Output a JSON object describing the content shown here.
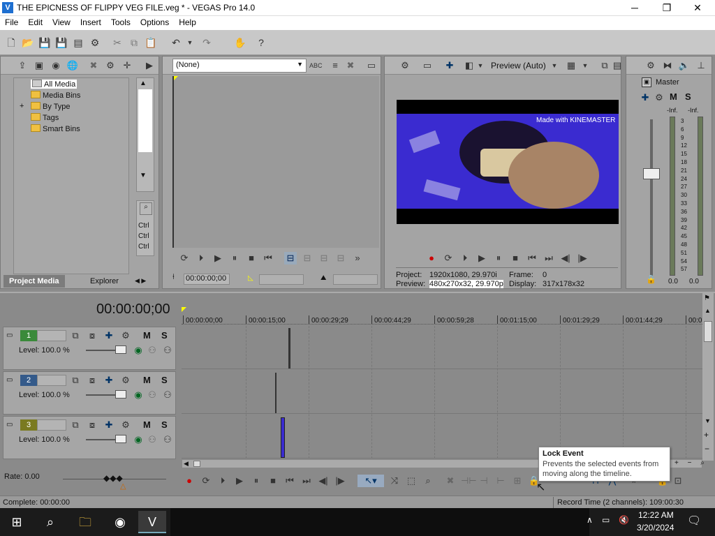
{
  "window": {
    "title": "THE EPICNESS OF FLIPPY VEG FILE.veg * - VEGAS Pro 14.0",
    "minimize": "─",
    "maximize": "❐",
    "close": "✕"
  },
  "menu": [
    "File",
    "Edit",
    "View",
    "Insert",
    "Tools",
    "Options",
    "Help"
  ],
  "project_media": {
    "tree": [
      "All Media",
      "Media Bins",
      "By Type",
      "Tags",
      "Smart Bins"
    ],
    "expander": "+",
    "tabs": [
      "Project Media",
      "Explorer"
    ],
    "ctrl": [
      "Ctrl",
      "Ctrl",
      "Ctrl"
    ]
  },
  "trimmer": {
    "dropdown": "(None)",
    "timecode": "00:00:00;00"
  },
  "preview": {
    "mode": "Preview (Auto)",
    "watermark": "Made with KINEMASTER",
    "project_label": "Project:",
    "project_value": "1920x1080, 29.970i",
    "frame_label": "Frame:",
    "frame_value": "0",
    "preview_label": "Preview:",
    "preview_value": "480x270x32, 29.970p",
    "display_label": "Display:",
    "display_value": "317x178x32"
  },
  "master": {
    "title": "Master",
    "m": "M",
    "s": "S",
    "inf_left": "-Inf.",
    "inf_right": "-Inf.",
    "scale": [
      "3",
      "6",
      "9",
      "12",
      "15",
      "18",
      "21",
      "24",
      "27",
      "30",
      "33",
      "36",
      "39",
      "42",
      "45",
      "48",
      "51",
      "54",
      "57"
    ],
    "value_left": "0.0",
    "value_right": "0.0"
  },
  "timeline": {
    "timecode": "00:00:00;00",
    "ruler": [
      "00:00:00;00",
      "00:00:15;00",
      "00:00:29;29",
      "00:00:44;29",
      "00:00:59;28",
      "00:01:15;00",
      "00:01:29;29",
      "00:01:44;29",
      "00:0"
    ],
    "tracks": [
      {
        "num": "1",
        "level": "Level: 100.0 %",
        "m": "M",
        "s": "S"
      },
      {
        "num": "2",
        "level": "Level: 100.0 %",
        "m": "M",
        "s": "S"
      },
      {
        "num": "3",
        "level": "Level: 100.0 %",
        "m": "M",
        "s": "S"
      }
    ],
    "rate": "Rate: 0.00"
  },
  "tooltip": {
    "title": "Lock Event",
    "body": "Prevents the selected events from moving along the timeline."
  },
  "status": {
    "left": "Complete: 00:00:00",
    "right": "Record Time (2 channels): 109:00:30"
  },
  "taskbar": {
    "time": "12:22 AM",
    "date": "3/20/2024"
  },
  "colors": {
    "video_bg": "#3a2bd0",
    "panel": "#a4a4a4",
    "taskbar": "#1b1b1b"
  }
}
